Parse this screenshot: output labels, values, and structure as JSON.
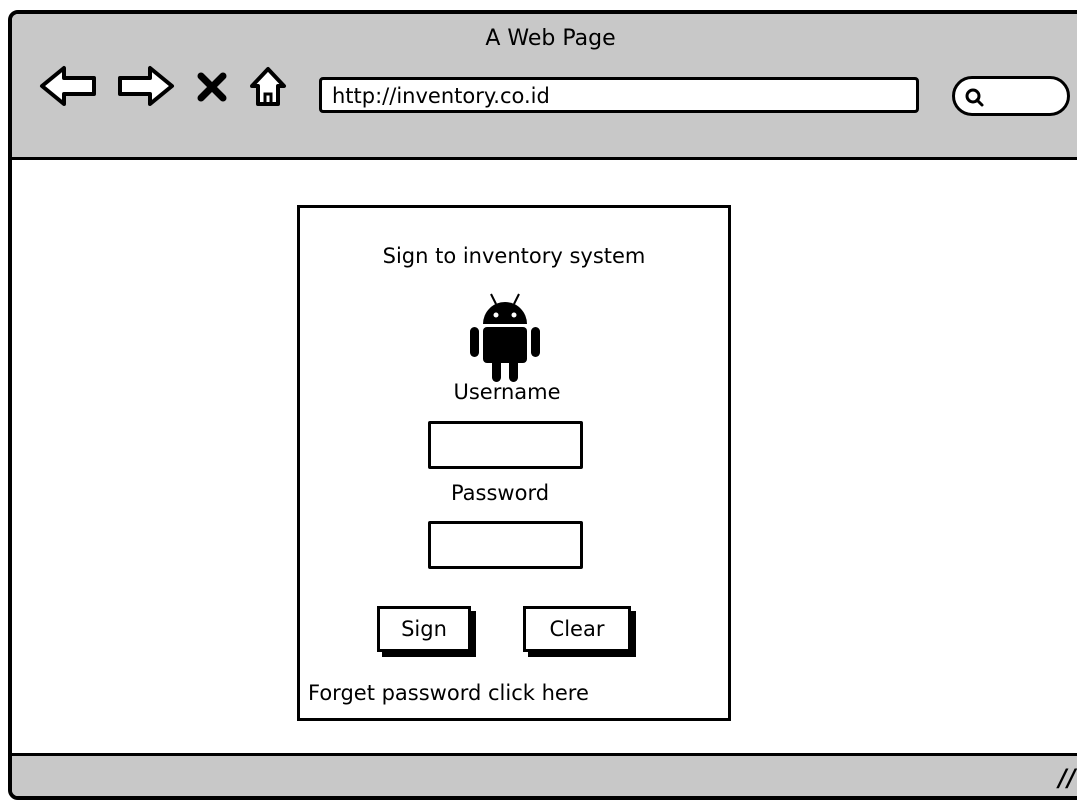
{
  "browser": {
    "title": "A Web Page",
    "url": "http://inventory.co.id",
    "nav_icons": [
      "back-arrow-icon",
      "forward-arrow-icon",
      "stop-icon",
      "home-icon"
    ],
    "search_icon": "search-icon"
  },
  "login": {
    "heading": "Sign to inventory system",
    "logo_icon": "android-icon",
    "username_label": "Username",
    "username_value": "",
    "password_label": "Password",
    "password_value": "",
    "sign_button": "Sign",
    "clear_button": "Clear",
    "forgot_text": "Forget password click here"
  }
}
